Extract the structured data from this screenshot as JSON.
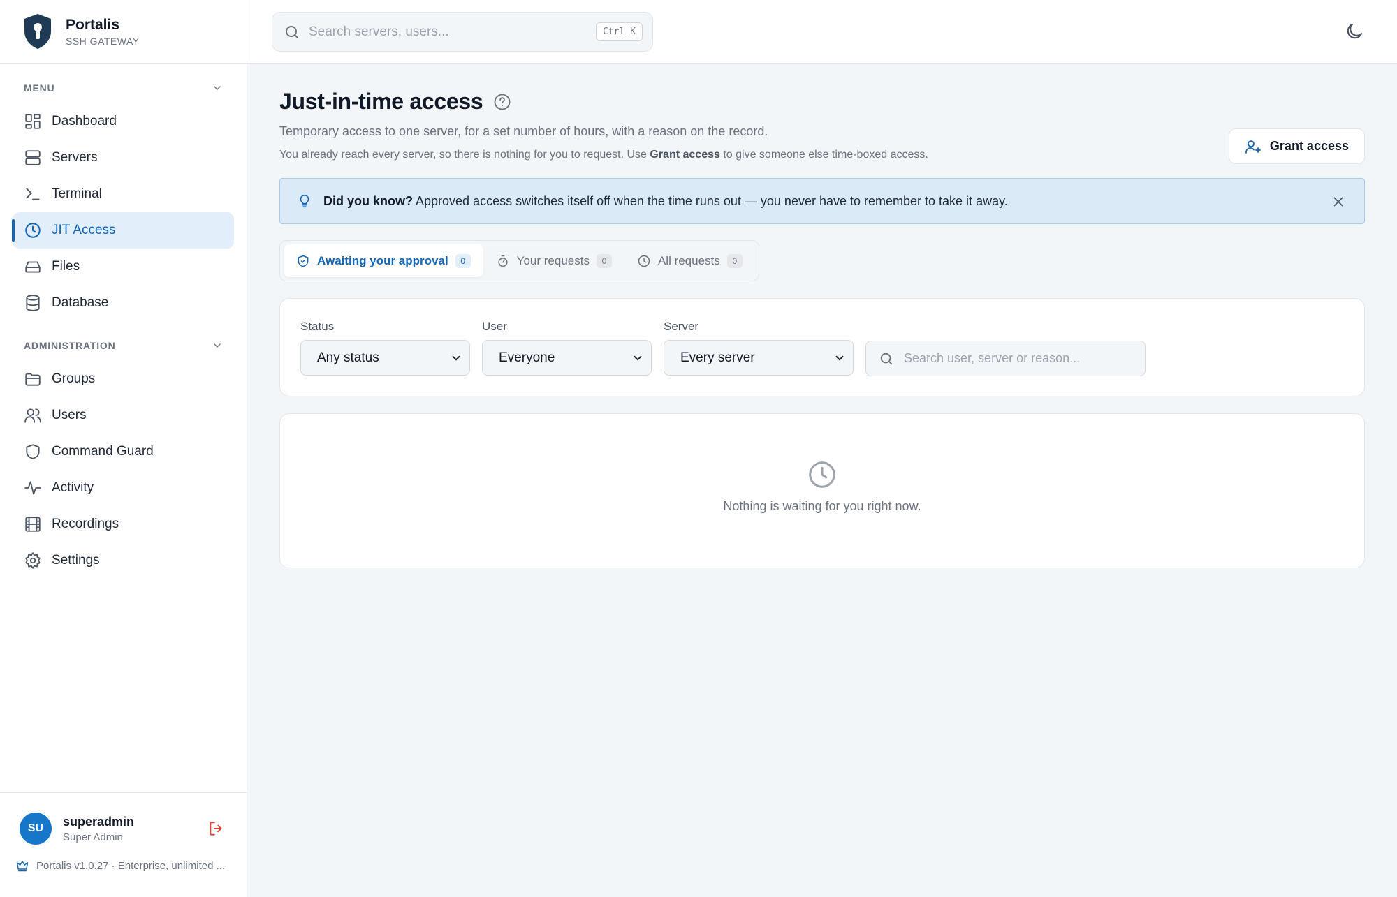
{
  "brand": {
    "name": "Portalis",
    "subtitle": "SSH GATEWAY"
  },
  "sidebar": {
    "menu_heading": "MENU",
    "menu_items": [
      {
        "label": "Dashboard",
        "icon": "dashboard-icon"
      },
      {
        "label": "Servers",
        "icon": "server-icon"
      },
      {
        "label": "Terminal",
        "icon": "terminal-icon"
      },
      {
        "label": "JIT Access",
        "icon": "clock-icon",
        "active": true
      },
      {
        "label": "Files",
        "icon": "drive-icon"
      },
      {
        "label": "Database",
        "icon": "database-icon"
      }
    ],
    "admin_heading": "ADMINISTRATION",
    "admin_items": [
      {
        "label": "Groups",
        "icon": "folder-icon"
      },
      {
        "label": "Users",
        "icon": "users-icon"
      },
      {
        "label": "Command Guard",
        "icon": "shield-icon"
      },
      {
        "label": "Activity",
        "icon": "activity-icon"
      },
      {
        "label": "Recordings",
        "icon": "film-icon"
      },
      {
        "label": "Settings",
        "icon": "gear-icon"
      }
    ]
  },
  "user": {
    "initials": "SU",
    "name": "superadmin",
    "role": "Super Admin"
  },
  "version": "Portalis v1.0.27 · Enterprise, unlimited ...",
  "topbar": {
    "search_placeholder": "Search servers, users...",
    "shortcut": "Ctrl K"
  },
  "page": {
    "title": "Just-in-time access",
    "subtitle": "Temporary access to one server, for a set number of hours, with a reason on the record.",
    "note_before": "You already reach every server, so there is nothing for you to request. Use ",
    "note_bold": "Grant access",
    "note_after": " to give someone else time-boxed access.",
    "grant_button": "Grant access"
  },
  "tip": {
    "lead": "Did you know?",
    "text": " Approved access switches itself off when the time runs out — you never have to remember to take it away."
  },
  "tabs": [
    {
      "label": "Awaiting your approval",
      "count": "0",
      "icon": "shield-check-icon",
      "active": true
    },
    {
      "label": "Your requests",
      "count": "0",
      "icon": "timer-icon"
    },
    {
      "label": "All requests",
      "count": "0",
      "icon": "clock-icon"
    }
  ],
  "filters": {
    "status_label": "Status",
    "status_value": "Any status",
    "user_label": "User",
    "user_value": "Everyone",
    "server_label": "Server",
    "server_value": "Every server",
    "search_placeholder": "Search user, server or reason..."
  },
  "empty_state": {
    "text": "Nothing is waiting for you right now."
  },
  "colors": {
    "accent": "#1166b8",
    "tip_bg": "#dbeaf7",
    "avatar": "#1677c9",
    "logout": "#d9453b"
  }
}
